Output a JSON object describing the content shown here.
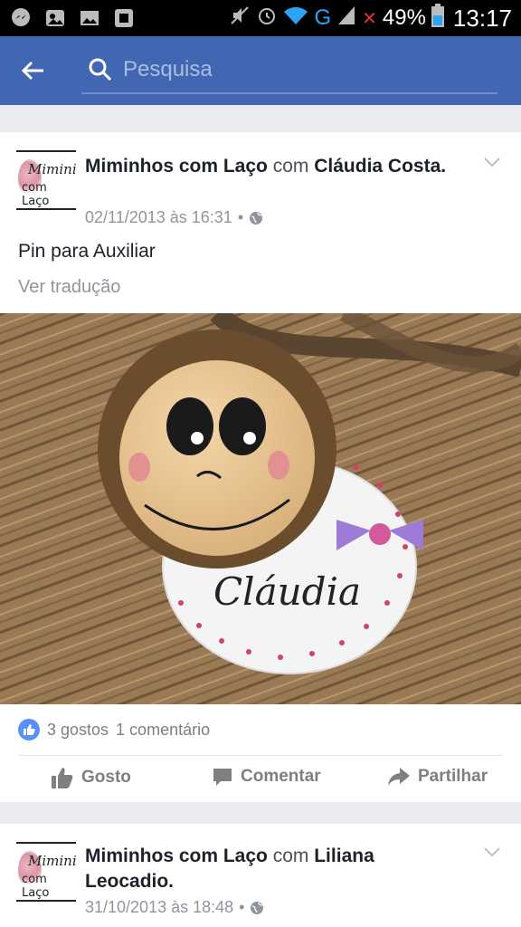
{
  "status_bar": {
    "battery_percent": "49%",
    "time": "13:17",
    "network": "G"
  },
  "header": {
    "search_placeholder": "Pesquisa"
  },
  "posts": [
    {
      "page_name": "Miminhos com Laço",
      "with_word": "com",
      "tagged": "Cláudia Costa.",
      "date": "02/11/2013 às 16:31",
      "separator": "•",
      "text": "Pin para Auxiliar",
      "translate": "Ver tradução",
      "photo_caption": "Cláudia",
      "reactions": "3 gostos",
      "comments": "1 comentário",
      "actions": [
        "Gosto",
        "Comentar",
        "Partilhar"
      ]
    },
    {
      "page_name": "Miminhos com Laço",
      "with_word": "com",
      "tagged": "Liliana Leocadio.",
      "date": "31/10/2013 às 18:48",
      "separator": "•"
    }
  ],
  "avatar": {
    "line1": "Mimini",
    "line2": "com Laço"
  },
  "colors": {
    "brand": "#4267b2",
    "like": "#5890ff",
    "text": "#1d2129",
    "muted": "#90949c"
  }
}
